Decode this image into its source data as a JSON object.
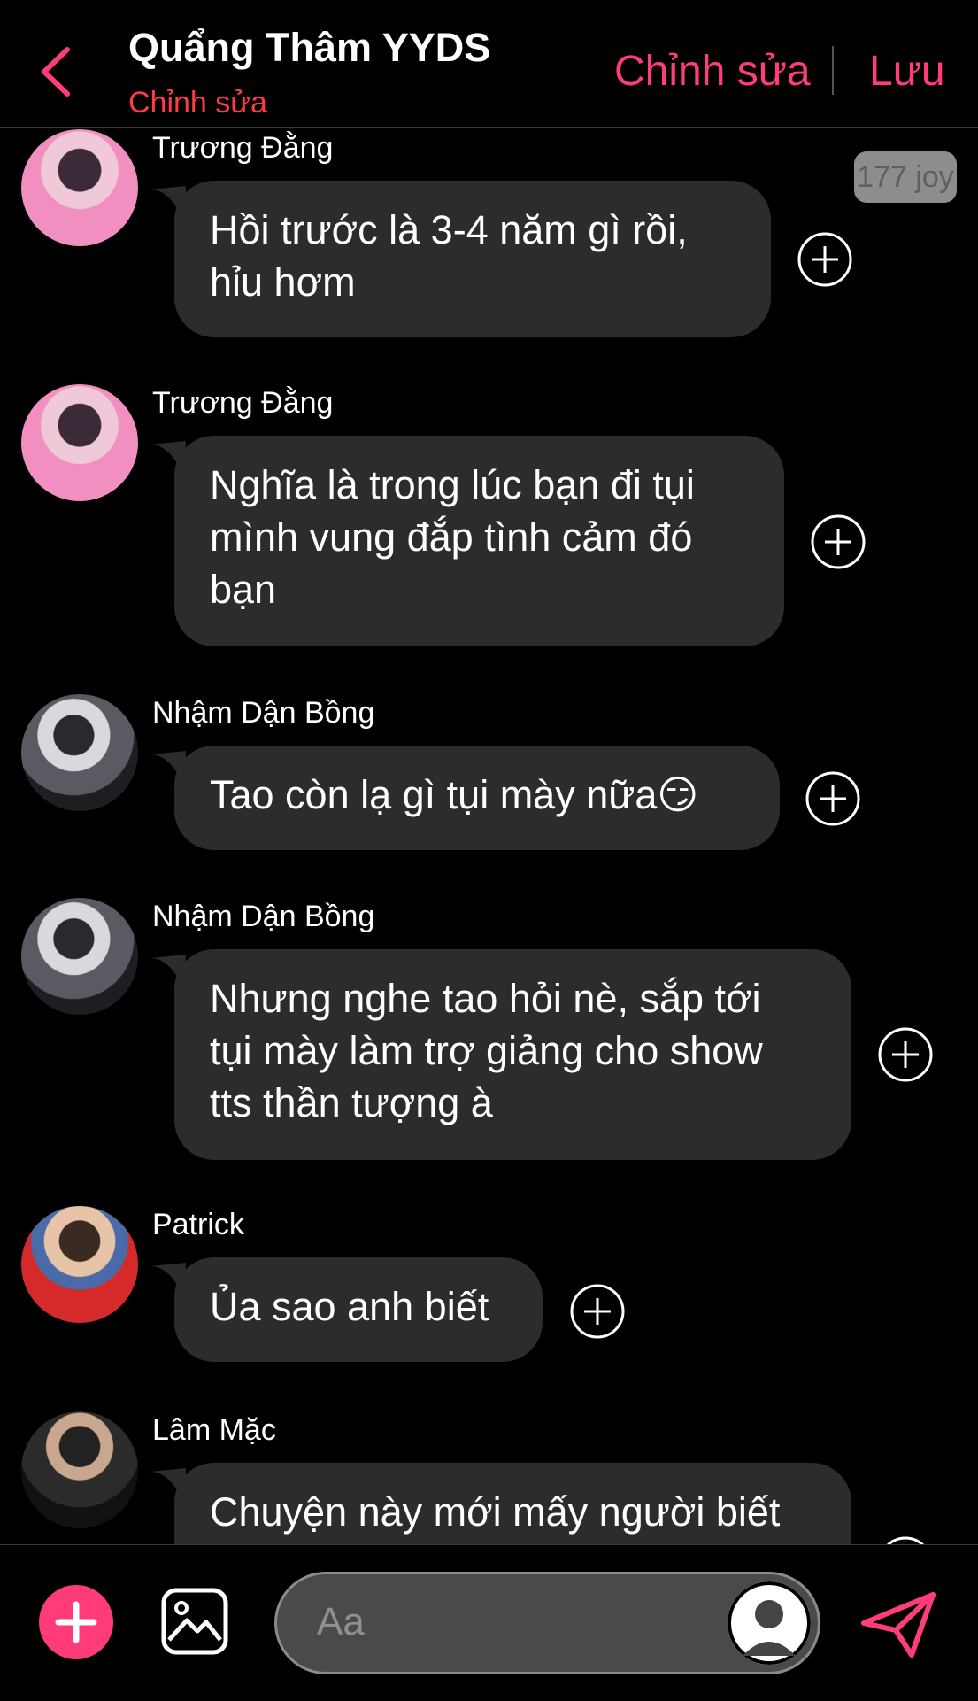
{
  "header": {
    "title": "Quẩng Thâm YYDS",
    "subtitle": "Chỉnh sửa",
    "edit_label": "Chỉnh sửa",
    "save_label": "Lưu"
  },
  "badge": {
    "text": "177 joy"
  },
  "messages": [
    {
      "sender": "Trương Đằng",
      "text": "Hồi trước là 3-4 năm gì rồi,\nhỉu hơm",
      "avatar_icon": "avatar-truong-dang"
    },
    {
      "sender": "Trương Đằng",
      "text": "Nghĩa là trong lúc bạn đi tụi\nmình vung đắp tình cảm đó\nbạn",
      "avatar_icon": "avatar-truong-dang"
    },
    {
      "sender": "Nhậm Dận Bồng",
      "text": "Tao còn lạ gì tụi mày nữa😏",
      "avatar_icon": "avatar-nham-dan-bong"
    },
    {
      "sender": "Nhậm Dận Bồng",
      "text": "Nhưng nghe tao hỏi nè, sắp tới\ntụi mày làm trợ giảng cho show\ntts thần tượng à",
      "avatar_icon": "avatar-nham-dan-bong"
    },
    {
      "sender": "Patrick",
      "text": "Ủa sao anh biết",
      "avatar_icon": "avatar-patrick"
    },
    {
      "sender": "Lâm Mặc",
      "text": "Chuyện này mới mấy người biết",
      "avatar_icon": "avatar-lam-mac"
    }
  ],
  "composer": {
    "placeholder": "Aa"
  },
  "colors": {
    "accent": "#ff3d7a",
    "subtitle": "#ff3b45",
    "bubble": "#2c2c2e",
    "background": "#000000"
  }
}
